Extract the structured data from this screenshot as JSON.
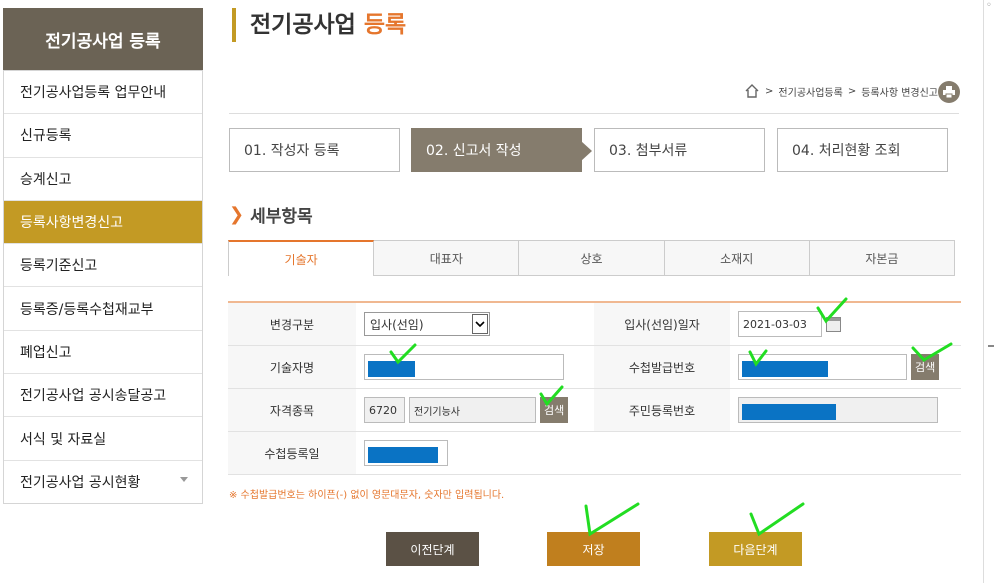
{
  "sidebar": {
    "title": "전기공사업 등록",
    "items": [
      {
        "label": "전기공사업등록 업무안내"
      },
      {
        "label": "신규등록"
      },
      {
        "label": "승계신고"
      },
      {
        "label": "등록사항변경신고"
      },
      {
        "label": "등록기준신고"
      },
      {
        "label": "등록증/등록수첩재교부"
      },
      {
        "label": "폐업신고"
      },
      {
        "label": "전기공사업 공시송달공고"
      },
      {
        "label": "서식 및 자료실"
      },
      {
        "label": "전기공사업 공시현황"
      }
    ]
  },
  "header": {
    "title_main": "전기공사업 ",
    "title_accent": "등록"
  },
  "breadcrumb": {
    "sep": ">",
    "crumb1": "전기공사업등록",
    "crumb2": "등록사항 변경신고"
  },
  "steps": [
    {
      "label": "01. 작성자 등록"
    },
    {
      "label": "02. 신고서 작성"
    },
    {
      "label": "03. 첨부서류"
    },
    {
      "label": "04. 처리현황 조회"
    }
  ],
  "section": {
    "title": "세부항목"
  },
  "tabs": [
    {
      "label": "기술자"
    },
    {
      "label": "대표자"
    },
    {
      "label": "상호"
    },
    {
      "label": "소재지"
    },
    {
      "label": "자본금"
    }
  ],
  "form": {
    "change_type_label": "변경구분",
    "change_type_value": "입사(선임)",
    "hire_date_label": "입사(선임)일자",
    "hire_date_value": "2021-03-03",
    "tech_name_label": "기술자명",
    "notebook_no_label": "수첩발급번호",
    "search_label": "검색",
    "qualification_label": "자격종목",
    "qualification_code": "6720",
    "qualification_name": "전기기능사",
    "resident_no_label": "주민등록번호",
    "notebook_date_label": "수첩등록일"
  },
  "note": "※ 수첩발급번호는 하이픈(-) 없이 영문대문자, 숫자만 입력됩니다.",
  "buttons": {
    "prev": "이전단계",
    "save": "저장",
    "next": "다음단계"
  },
  "colors": {
    "gold": "#c39a24",
    "brown": "#857c6d",
    "orange": "#e5762d",
    "mask_blue": "#0a73c4",
    "check_green": "#22dd22"
  }
}
